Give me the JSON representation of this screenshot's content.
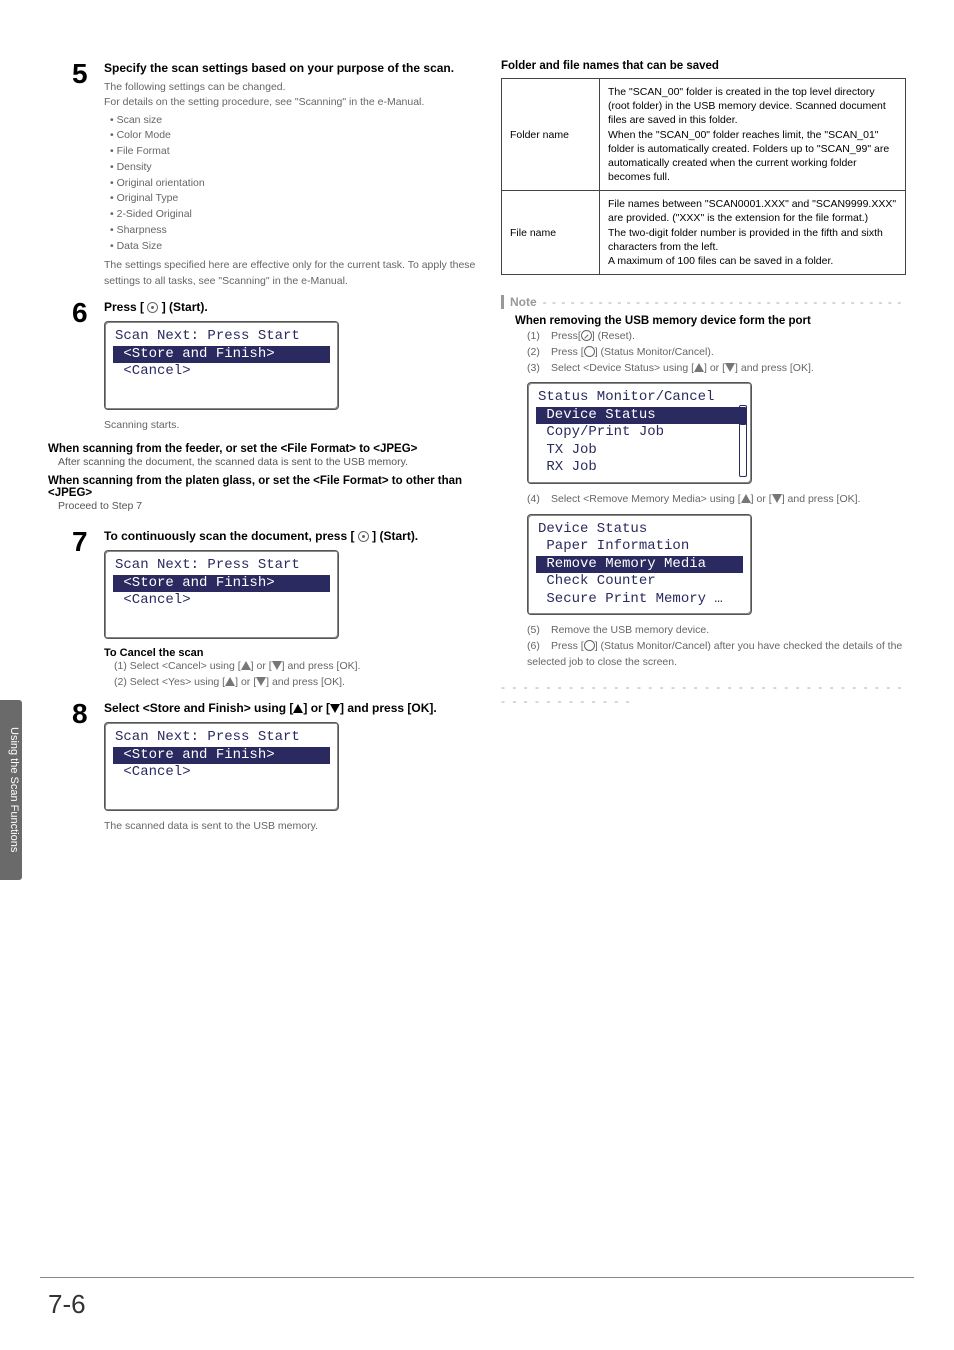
{
  "sidebar": {
    "label": "Using the Scan Functions"
  },
  "steps": {
    "s5": {
      "num": "5",
      "title": "Specify the scan settings based on your purpose of the scan.",
      "intro1": "The following settings can be changed.",
      "intro2": "For details on the setting procedure, see \"Scanning\" in the e-Manual.",
      "bullets": [
        "Scan size",
        "Color Mode",
        "File Format",
        "Density",
        "Original orientation",
        "Original Type",
        "2-Sided Original",
        "Sharpness",
        "Data Size"
      ],
      "note": "The settings specified here are effective only for the current task. To apply these settings to all tasks, see \"Scanning\" in the e-Manual."
    },
    "s6": {
      "num": "6",
      "title_parts": [
        "Press [ ",
        " ] (Start)."
      ],
      "lcd": {
        "line1": "Scan Next: Press Start",
        "line2": " <Store and Finish>",
        "line3": " <Cancel>"
      },
      "after": "Scanning starts.",
      "blockA_head": "When scanning from the feeder, or set the <File Format> to <JPEG>",
      "blockA_body": "After scanning the document, the scanned data is sent to the USB memory.",
      "blockB_head": "When scanning from the platen glass, or set the <File Format> to other than <JPEG>",
      "blockB_body": "Proceed to Step 7"
    },
    "s7": {
      "num": "7",
      "title_parts": [
        "To continuously scan the document, press [ ",
        " ] (Start)."
      ],
      "lcd": {
        "line1": "Scan Next: Press Start",
        "line2": " <Store and Finish>",
        "line3": " <Cancel>"
      },
      "cancel_head": "To Cancel the scan",
      "cancel1_pre": "(1) Select <Cancel> using [",
      "cancel_mid": "] or [",
      "cancel_post": "] and press [OK].",
      "cancel2_pre": "(2) Select <Yes> using ["
    },
    "s8": {
      "num": "8",
      "title_pre": "Select <Store and Finish> using [",
      "title_mid": "] or [",
      "title_post": "] and press [OK].",
      "lcd": {
        "line1": "Scan Next: Press Start",
        "line2": " <Store and Finish>",
        "line3": " <Cancel>"
      },
      "after": "The scanned data is sent to the USB memory."
    }
  },
  "right": {
    "tableTitle": "Folder and file names that can be saved",
    "rows": [
      {
        "key": "Folder name",
        "val": "The \"SCAN_00\" folder is created in the top level directory (root folder) in the USB memory device. Scanned document files are saved in this folder.\nWhen the \"SCAN_00\" folder reaches limit, the \"SCAN_01\" folder is automatically created. Folders up to \"SCAN_99\" are automatically created when the current working folder becomes full."
      },
      {
        "key": "File name",
        "val": "File names between \"SCAN0001.XXX\" and \"SCAN9999.XXX\" are provided. (\"XXX\" is the extension for the file format.)\nThe two-digit folder number is provided in the fifth and sixth characters from the left.\nA maximum of 100 files can be saved in a folder."
      }
    ],
    "note": {
      "label": "Note",
      "title": "When removing the USB memory device form the port",
      "items123": {
        "i1_pre": "Press[",
        "i1_post": "] (Reset).",
        "i2_pre": "Press [",
        "i2_post": "] (Status Monitor/Cancel).",
        "i3_pre": "Select <Device Status> using [",
        "i3_mid": "] or [",
        "i3_post": "] and press [OK]."
      },
      "lcd1": {
        "title": "Status Monitor/Cancel",
        "l1": " Device Status",
        "l2": " Copy/Print Job",
        "l3": " TX Job",
        "l4": " RX Job"
      },
      "i4_pre": "Select <Remove Memory Media> using [",
      "i4_mid": "] or [",
      "i4_post": "] and press [OK].",
      "lcd2": {
        "title": "Device Status",
        "l1": " Paper Information",
        "l2": " Remove Memory Media",
        "l3": " Check Counter",
        "l4": " Secure Print Memory …"
      },
      "i5": "Remove the USB memory device.",
      "i6_pre": "Press [",
      "i6_post": "] (Status Monitor/Cancel) after you have checked the details of the selected job to close the screen."
    }
  },
  "footer": {
    "page": "7-6"
  }
}
